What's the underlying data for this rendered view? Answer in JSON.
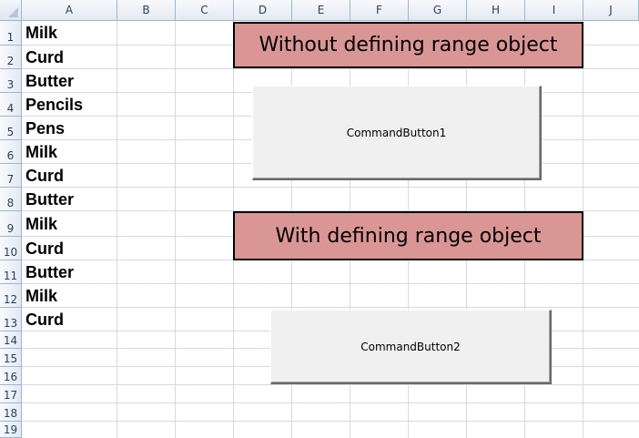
{
  "columns": [
    "A",
    "B",
    "C",
    "D",
    "E",
    "F",
    "G",
    "H",
    "I",
    "J"
  ],
  "rows": [
    "1",
    "2",
    "3",
    "4",
    "5",
    "6",
    "7",
    "8",
    "9",
    "10",
    "11",
    "12",
    "13",
    "14",
    "15",
    "16",
    "17",
    "18",
    "19"
  ],
  "column_a_values": [
    "Milk",
    "Curd",
    "Butter",
    "Pencils",
    "Pens",
    "Milk",
    "Curd",
    "Butter",
    "Milk",
    "Curd",
    "Butter",
    "Milk",
    "Curd"
  ],
  "banner_top": "Without defining range object",
  "banner_bottom": "With defining range object",
  "button1_caption": "CommandButton1",
  "button2_caption": "CommandButton2",
  "colors": {
    "banner_fill": "#da9694",
    "header_border": "#9eb6ce",
    "gridline": "#d4dbe5",
    "button_face": "#f0f0f0"
  }
}
